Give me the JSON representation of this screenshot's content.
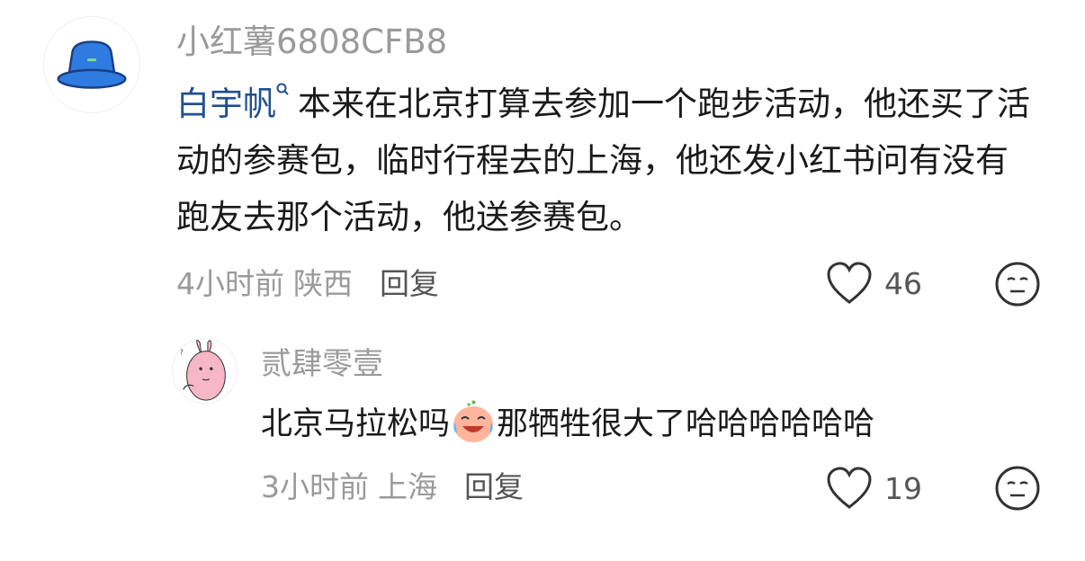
{
  "comment": {
    "username": "小红薯6808CFB8",
    "mention": "白宇帆",
    "text": "本来在北京打算去参加一个跑步活动，他还买了活动的参赛包，临时行程去的上海，他还发小红书问有没有跑友去那个活动，他送参赛包。",
    "time": "4小时前",
    "location": "陕西",
    "reply_label": "回复",
    "like_count": "46",
    "avatar_icon": "bucket-hat-avatar",
    "accent_color": "#1f4f8f"
  },
  "reply": {
    "username": "贰肆零壹",
    "text_before_emoji": "北京马拉松吗",
    "emoji_icon": "crying-laughing-peach-emoji",
    "text_after_emoji": "那牺牲很大了哈哈哈哈哈哈",
    "time": "3小时前",
    "location": "上海",
    "reply_label": "回复",
    "like_count": "19",
    "avatar_icon": "pink-rabbit-avatar"
  }
}
